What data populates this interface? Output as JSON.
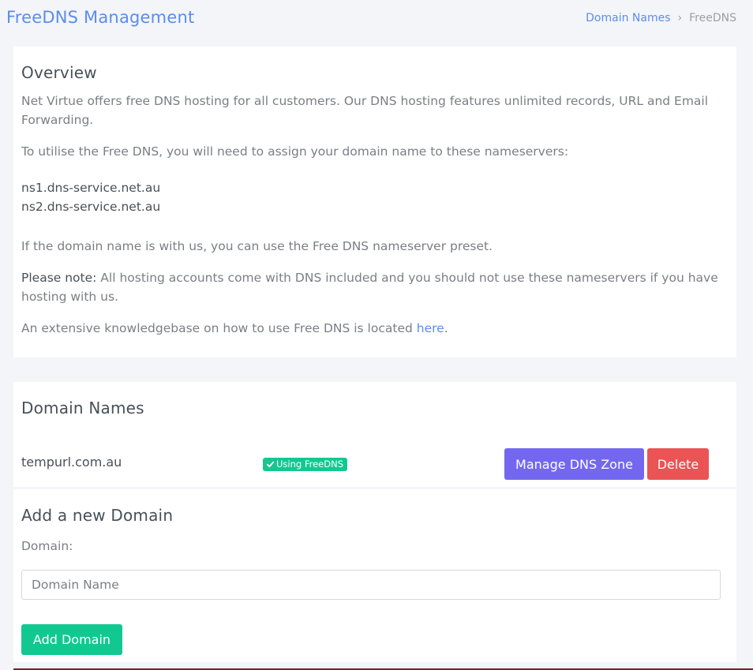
{
  "header": {
    "title": "FreeDNS Management",
    "breadcrumb": {
      "link": "Domain Names",
      "separator": "›",
      "current": "FreeDNS"
    }
  },
  "overview": {
    "title": "Overview",
    "intro": "Net Virtue offers free DNS hosting for all customers. Our DNS hosting features unlimited records, URL and Email Forwarding.",
    "assign_text": "To utilise the Free DNS, you will need to assign your domain name to these nameservers:",
    "nameservers": [
      "ns1.dns-service.net.au",
      "ns2.dns-service.net.au"
    ],
    "preset_text": "If the domain name is with us, you can use the Free DNS nameserver preset.",
    "note_label": "Please note:",
    "note_text": " All hosting accounts come with DNS included and you should not use these nameservers if you have hosting with us.",
    "kb_text": "An extensive knowledgebase on how to use Free DNS is located ",
    "kb_link": "here",
    "kb_end": "."
  },
  "domains": {
    "title": "Domain Names",
    "items": [
      {
        "name": "tempurl.com.au",
        "status": "Using FreeDNS",
        "manage_label": "Manage DNS Zone",
        "delete_label": "Delete"
      }
    ]
  },
  "add_domain": {
    "title": "Add a new Domain",
    "label": "Domain:",
    "placeholder": "Domain Name",
    "value": "",
    "button_label": "Add Domain"
  },
  "colors": {
    "accent": "#5a8dee",
    "manage": "#7367f0",
    "delete": "#ea5455",
    "success": "#12c891"
  }
}
